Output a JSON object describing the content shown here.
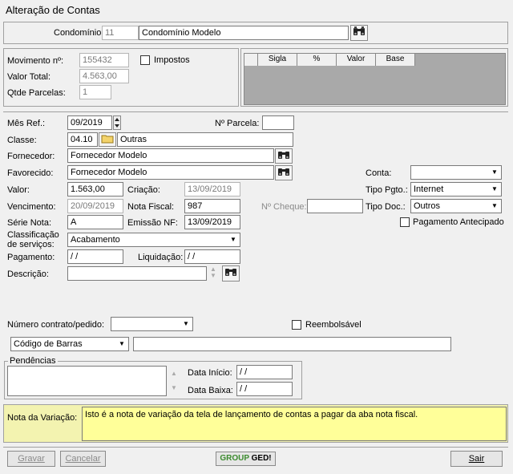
{
  "window": {
    "title": "Alteração de Contas"
  },
  "header": {
    "condominio_label": "Condomínio:",
    "condominio_code": "11",
    "condominio_name": "Condomínio Modelo"
  },
  "movimento": {
    "movimento_label": "Movimento nº:",
    "movimento_value": "155432",
    "valor_total_label": "Valor Total:",
    "valor_total_value": "4.563,00",
    "qtde_parcelas_label": "Qtde Parcelas:",
    "qtde_parcelas_value": "1",
    "impostos_label": "Impostos"
  },
  "impostos_grid": {
    "columns": [
      "Sigla",
      "%",
      "Valor",
      "Base"
    ]
  },
  "form": {
    "mes_ref_label": "Mês Ref.:",
    "mes_ref_value": "09/2019",
    "n_parcela_label": "Nº Parcela:",
    "n_parcela_value": "",
    "classe_label": "Classe:",
    "classe_code": "04.10",
    "classe_name": "Outras",
    "fornecedor_label": "Fornecedor:",
    "fornecedor_value": "Fornecedor Modelo",
    "favorecido_label": "Favorecido:",
    "favorecido_value": "Fornecedor Modelo",
    "conta_label": "Conta:",
    "conta_value": "",
    "valor_label": "Valor:",
    "valor_value": "1.563,00",
    "criacao_label": "Criação:",
    "criacao_value": "13/09/2019",
    "tipo_pgto_label": "Tipo Pgto.:",
    "tipo_pgto_value": "Internet",
    "vencimento_label": "Vencimento:",
    "vencimento_value": "20/09/2019",
    "nota_fiscal_label": "Nota Fiscal:",
    "nota_fiscal_value": "987",
    "n_cheque_label": "Nº Cheque:",
    "n_cheque_value": "",
    "tipo_doc_label": "Tipo Doc.:",
    "tipo_doc_value": "Outros",
    "serie_nota_label": "Série Nota:",
    "serie_nota_value": "A",
    "emissao_nf_label": "Emissão NF:",
    "emissao_nf_value": "13/09/2019",
    "pagamento_antecipado_label": "Pagamento Antecipado",
    "classificacao_label_1": "Classificação",
    "classificacao_label_2": "de serviços:",
    "classificacao_value": "Acabamento",
    "pagamento_label": "Pagamento:",
    "pagamento_value": " / /",
    "liquidacao_label": "Liquidação:",
    "liquidacao_value": " / /",
    "descricao_label": "Descrição:",
    "descricao_value": "",
    "numero_contrato_label": "Número contrato/pedido:",
    "numero_contrato_value": "",
    "reembolsavel_label": "Reembolsável",
    "barcode_type_value": "Código de Barras",
    "barcode_value": ""
  },
  "pendencias": {
    "legend": "Pendências",
    "data_inicio_label": "Data Início:",
    "data_inicio_value": " / /",
    "data_baixa_label": "Data Baixa:",
    "data_baixa_value": " / /"
  },
  "nota_variacao": {
    "label": "Nota da Variação:",
    "text": "Isto é a nota de variação da tela de lançamento de contas a pagar da aba nota fiscal."
  },
  "footer": {
    "gravar_label": "Gravar",
    "cancelar_label": "Cancelar",
    "brand_group": "GROUP",
    "brand_ged": "GED!",
    "sair_label": "Sair"
  },
  "colors": {
    "note_bg": "#ffff99",
    "brand_green": "#3b8a2e"
  },
  "icons": [
    "binoculars-icon",
    "folder-icon",
    "spin-arrows-icon",
    "chevron-down-icon"
  ]
}
